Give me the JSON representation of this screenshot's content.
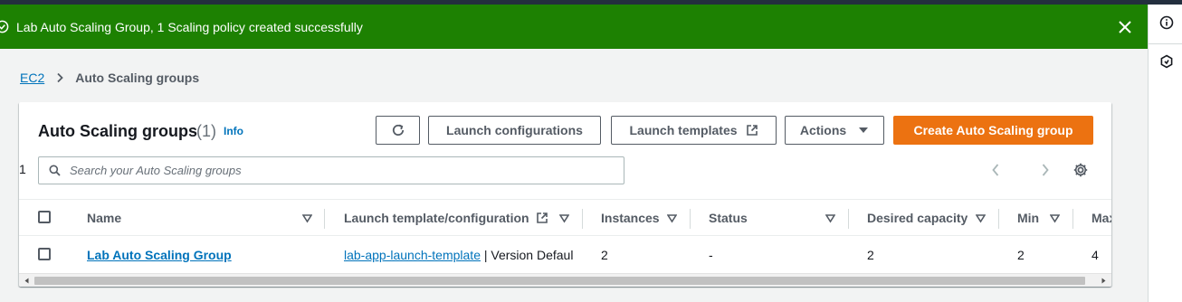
{
  "flash": {
    "message": "Lab Auto Scaling Group, 1 Scaling policy created successfully",
    "color": "#1d8102"
  },
  "breadcrumb": {
    "root": "EC2",
    "current": "Auto Scaling groups"
  },
  "panel": {
    "title": "Auto Scaling groups",
    "count": "(1)",
    "info": "Info"
  },
  "toolbar": {
    "refresh_icon": "refresh-icon",
    "launch_configurations": "Launch configurations",
    "launch_templates": "Launch templates",
    "actions": "Actions",
    "create": "Create Auto Scaling group",
    "create_color": "#ec7211"
  },
  "search": {
    "placeholder": "Search your Auto Scaling groups",
    "value": ""
  },
  "pagination": {
    "current_page": "1"
  },
  "table": {
    "columns": [
      "Name",
      "Launch template/configuration",
      "Instances",
      "Status",
      "Desired capacity",
      "Min",
      "Max"
    ],
    "rows": [
      {
        "name": "Lab Auto Scaling Group",
        "launch_template_link": "lab-app-launch-template",
        "launch_template_suffix": " | Version Defaul",
        "instances": "2",
        "status": "-",
        "desired_capacity": "2",
        "min": "2",
        "max": "4"
      }
    ]
  },
  "rail": {
    "icons": [
      "info-icon",
      "hexagon-icon"
    ]
  }
}
